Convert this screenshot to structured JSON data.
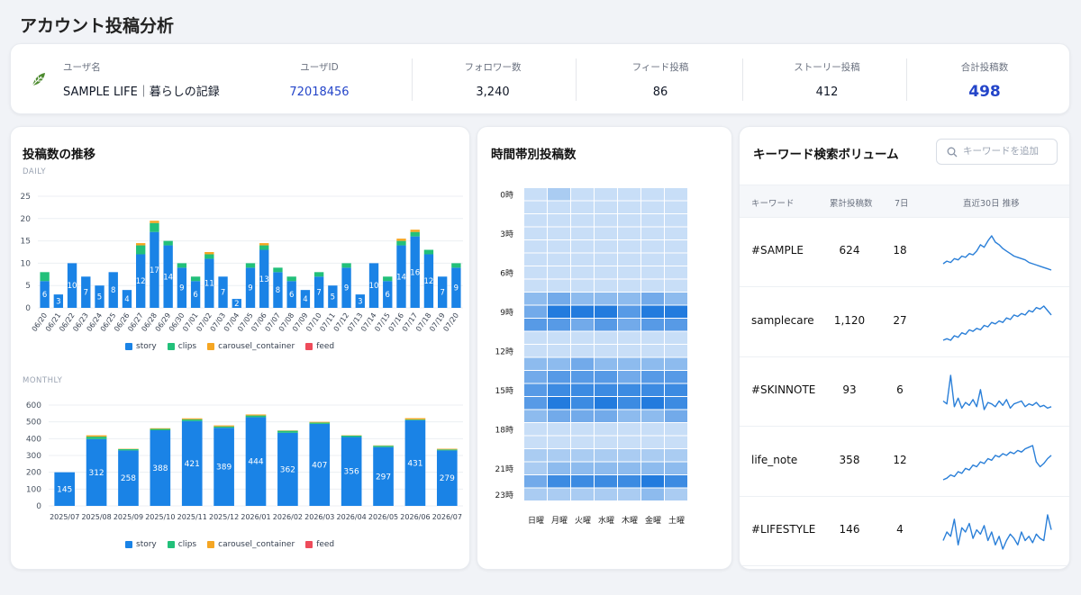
{
  "page_title": "アカウント投稿分析",
  "summary": {
    "user_name_label": "ユーザ名",
    "user_name": "SAMPLE LIFE｜暮らしの記録",
    "user_id_label": "ユーザID",
    "user_id": "72018456",
    "followers_label": "フォロワー数",
    "followers": "3,240",
    "feed_label": "フィード投稿",
    "feed": "86",
    "story_label": "ストーリー投稿",
    "story": "412",
    "total_label": "合計投稿数",
    "total": "498",
    "accent_color": "#2445c9",
    "icon": "leaf-icon"
  },
  "posts_trend": {
    "title": "投稿数の推移",
    "daily_label": "DAILY",
    "monthly_label": "MONTHLY"
  },
  "legend": [
    {
      "name": "story",
      "color": "#1a83e6"
    },
    {
      "name": "clips",
      "color": "#22c07a"
    },
    {
      "name": "carousel_container",
      "color": "#f5a623"
    },
    {
      "name": "feed",
      "color": "#ee4b5a"
    }
  ],
  "heatmap_card": {
    "title": "時間帯別投稿数"
  },
  "keywords": {
    "title": "キーワード検索ボリューム",
    "search_placeholder": "キーワードを追加",
    "col_keyword": "キーワード",
    "col_total": "累計投稿数",
    "col_7d": "7日",
    "col_trend": "直近30日 推移",
    "rows": [
      {
        "keyword": "#SAMPLE",
        "total": "624",
        "d7": "18",
        "trend": [
          40,
          42,
          41,
          44,
          43,
          46,
          45,
          48,
          47,
          50,
          55,
          53,
          58,
          62,
          57,
          55,
          52,
          50,
          48,
          46,
          45,
          44,
          43,
          41,
          40,
          39,
          38,
          37,
          36,
          35
        ]
      },
      {
        "keyword": "samplecare",
        "total": "1,120",
        "d7": "27",
        "trend": [
          30,
          31,
          30,
          33,
          32,
          35,
          34,
          37,
          36,
          38,
          37,
          40,
          39,
          42,
          41,
          43,
          42,
          45,
          44,
          47,
          46,
          48,
          47,
          50,
          49,
          52,
          51,
          53,
          50,
          47
        ]
      },
      {
        "keyword": "#SKINNOTE",
        "total": "93",
        "d7": "6",
        "trend": [
          42,
          40,
          60,
          38,
          44,
          37,
          41,
          39,
          43,
          38,
          50,
          36,
          41,
          40,
          38,
          42,
          39,
          43,
          37,
          40,
          41,
          42,
          38,
          40,
          39,
          41,
          38,
          39,
          37,
          38
        ]
      },
      {
        "keyword": "life_note",
        "total": "358",
        "d7": "12",
        "trend": [
          30,
          31,
          33,
          32,
          35,
          34,
          37,
          36,
          39,
          38,
          41,
          40,
          43,
          42,
          45,
          44,
          46,
          45,
          47,
          46,
          48,
          47,
          49,
          50,
          51,
          41,
          38,
          40,
          43,
          45
        ]
      },
      {
        "keyword": "#LIFESTYLE",
        "total": "146",
        "d7": "4",
        "trend": [
          40,
          44,
          42,
          50,
          38,
          46,
          44,
          48,
          41,
          45,
          43,
          47,
          40,
          44,
          38,
          42,
          36,
          40,
          43,
          41,
          38,
          44,
          40,
          42,
          39,
          43,
          41,
          40,
          52,
          45
        ]
      }
    ]
  },
  "chart_data": [
    {
      "type": "bar",
      "title": "DAILY",
      "stacked": true,
      "ylim": [
        0,
        25
      ],
      "yticks": [
        0,
        5,
        10,
        15,
        20,
        25
      ],
      "categories": [
        "06/20",
        "06/21",
        "06/22",
        "06/23",
        "06/24",
        "06/25",
        "06/26",
        "06/27",
        "06/28",
        "06/29",
        "06/30",
        "07/01",
        "07/02",
        "07/03",
        "07/04",
        "07/05",
        "07/06",
        "07/07",
        "07/08",
        "07/09",
        "07/10",
        "07/11",
        "07/12",
        "07/13",
        "07/14",
        "07/15",
        "07/16",
        "07/17",
        "07/18",
        "07/19",
        "07/20"
      ],
      "series": [
        {
          "name": "story",
          "values": [
            6,
            3,
            10,
            7,
            5,
            8,
            4,
            12,
            17,
            14,
            9,
            6,
            11,
            7,
            2,
            9,
            13,
            8,
            6,
            4,
            7,
            5,
            9,
            3,
            10,
            6,
            14,
            16,
            12,
            7,
            9
          ]
        },
        {
          "name": "clips",
          "values": [
            2,
            0,
            0,
            0,
            0,
            0,
            0,
            2,
            2,
            1,
            1,
            1,
            1,
            0,
            0,
            1,
            1,
            1,
            1,
            0,
            1,
            0,
            1,
            0,
            0,
            1,
            1,
            1,
            1,
            0,
            1
          ]
        },
        {
          "name": "carousel_container",
          "values": [
            0,
            0,
            0,
            0,
            0,
            0,
            0,
            0.5,
            0.5,
            0,
            0,
            0,
            0.5,
            0,
            0,
            0,
            0.5,
            0,
            0,
            0,
            0,
            0,
            0,
            0,
            0,
            0,
            0.5,
            0.5,
            0,
            0,
            0
          ]
        },
        {
          "name": "feed",
          "values": [
            0,
            0,
            0,
            0,
            0,
            0,
            0,
            0,
            0,
            0,
            0,
            0,
            0,
            0,
            0,
            0,
            0,
            0,
            0,
            0,
            0,
            0,
            0,
            0,
            0,
            0,
            0,
            0,
            0,
            0,
            0
          ]
        }
      ],
      "data_labels": [
        "6",
        "3",
        "10",
        "7",
        "5",
        "8",
        "4",
        "12",
        "17",
        "14",
        "9",
        "6",
        "11",
        "7",
        "2",
        "9",
        "13",
        "8",
        "6",
        "4",
        "7",
        "5",
        "9",
        "3",
        "10",
        "6",
        "14",
        "16",
        "12",
        "7",
        "9"
      ]
    },
    {
      "type": "bar",
      "title": "MONTHLY",
      "stacked": true,
      "ylim": [
        0,
        600
      ],
      "yticks": [
        0,
        100,
        200,
        300,
        400,
        500,
        600
      ],
      "categories": [
        "2025/07",
        "2025/08",
        "2025/09",
        "2025/10",
        "2025/11",
        "2025/12",
        "2026/01",
        "2026/02",
        "2026/03",
        "2026/04",
        "2026/05",
        "2026/06",
        "2026/07"
      ],
      "series": [
        {
          "name": "story",
          "values": [
            200,
            398,
            330,
            450,
            505,
            465,
            528,
            435,
            488,
            410,
            350,
            510,
            330
          ]
        },
        {
          "name": "clips",
          "values": [
            0,
            14,
            8,
            8,
            10,
            8,
            10,
            12,
            8,
            8,
            8,
            4,
            6
          ]
        },
        {
          "name": "carousel_container",
          "values": [
            0,
            8,
            2,
            4,
            6,
            6,
            6,
            2,
            4,
            2,
            2,
            8,
            4
          ]
        },
        {
          "name": "feed",
          "values": [
            0,
            0,
            0,
            0,
            0,
            0,
            0,
            0,
            0,
            0,
            0,
            0,
            0
          ]
        }
      ],
      "data_labels": [
        "145",
        "312",
        "258",
        "388",
        "421",
        "389",
        "444",
        "362",
        "407",
        "356",
        "297",
        "431",
        "279"
      ]
    },
    {
      "type": "heatmap",
      "title": "時間帯別投稿数",
      "x": [
        "日曜",
        "月曜",
        "火曜",
        "水曜",
        "木曜",
        "金曜",
        "土曜"
      ],
      "y_tick_labels": [
        "0時",
        "3時",
        "6時",
        "9時",
        "12時",
        "15時",
        "18時",
        "21時",
        "23時"
      ],
      "y_hours": [
        0,
        1,
        2,
        3,
        4,
        5,
        6,
        7,
        8,
        9,
        10,
        11,
        12,
        13,
        14,
        15,
        16,
        17,
        18,
        19,
        20,
        21,
        22,
        23
      ],
      "values": [
        [
          1,
          2,
          1,
          1,
          1,
          1,
          1
        ],
        [
          1,
          1,
          1,
          1,
          1,
          1,
          1
        ],
        [
          1,
          1,
          1,
          1,
          1,
          1,
          1
        ],
        [
          1,
          1,
          1,
          1,
          1,
          1,
          1
        ],
        [
          1,
          1,
          1,
          1,
          1,
          1,
          1
        ],
        [
          1,
          1,
          1,
          1,
          1,
          1,
          1
        ],
        [
          1,
          1,
          1,
          1,
          1,
          1,
          1
        ],
        [
          1,
          1,
          1,
          1,
          1,
          1,
          1
        ],
        [
          3,
          4,
          3,
          3,
          3,
          4,
          3
        ],
        [
          4,
          7,
          7,
          7,
          5,
          7,
          7
        ],
        [
          5,
          5,
          4,
          5,
          4,
          5,
          5
        ],
        [
          1,
          1,
          1,
          1,
          1,
          1,
          1
        ],
        [
          1,
          1,
          1,
          1,
          1,
          1,
          1
        ],
        [
          3,
          3,
          4,
          3,
          3,
          3,
          3
        ],
        [
          4,
          5,
          5,
          5,
          4,
          5,
          5
        ],
        [
          5,
          6,
          6,
          6,
          6,
          6,
          6
        ],
        [
          5,
          7,
          6,
          7,
          6,
          7,
          6
        ],
        [
          3,
          4,
          4,
          4,
          3,
          3,
          4
        ],
        [
          1,
          1,
          1,
          1,
          1,
          1,
          1
        ],
        [
          1,
          1,
          1,
          1,
          1,
          1,
          1
        ],
        [
          2,
          2,
          2,
          2,
          2,
          2,
          2
        ],
        [
          2,
          3,
          3,
          3,
          3,
          3,
          3
        ],
        [
          4,
          6,
          6,
          6,
          6,
          7,
          6
        ],
        [
          2,
          2,
          2,
          2,
          2,
          3,
          2
        ]
      ]
    }
  ]
}
